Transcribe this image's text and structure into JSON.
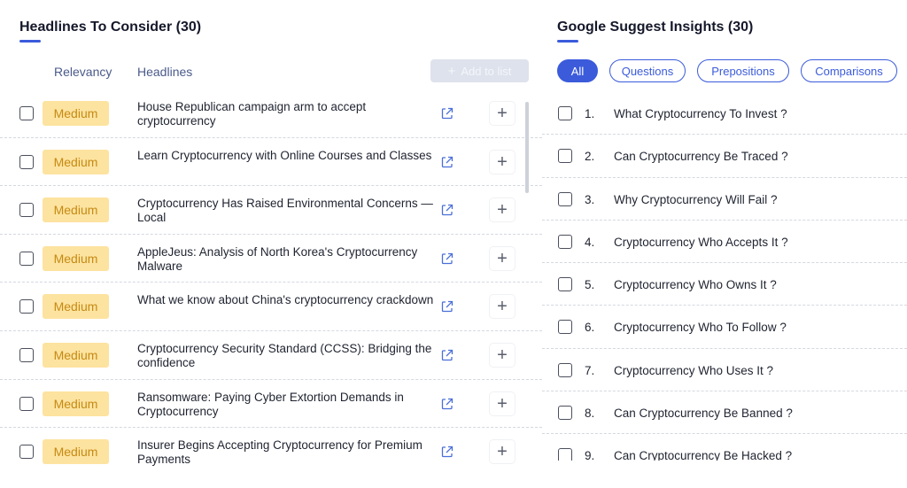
{
  "headlines": {
    "title": "Headlines To Consider (30)",
    "col_relevancy": "Relevancy",
    "col_headlines": "Headlines",
    "add_to_list": "Add to list",
    "items": [
      {
        "relevancy": "Medium",
        "text": "House Republican campaign arm to accept cryptocurrency"
      },
      {
        "relevancy": "Medium",
        "text": "Learn Cryptocurrency with Online Courses and Classes"
      },
      {
        "relevancy": "Medium",
        "text": "Cryptocurrency Has Raised Environmental Concerns — Local"
      },
      {
        "relevancy": "Medium",
        "text": "AppleJeus: Analysis of North Korea's Cryptocurrency Malware"
      },
      {
        "relevancy": "Medium",
        "text": "What we know about China's cryptocurrency crackdown"
      },
      {
        "relevancy": "Medium",
        "text": "Cryptocurrency Security Standard (CCSS): Bridging the confidence"
      },
      {
        "relevancy": "Medium",
        "text": "Ransomware: Paying Cyber Extortion Demands in Cryptocurrency"
      },
      {
        "relevancy": "Medium",
        "text": "Insurer Begins Accepting Cryptocurrency for Premium Payments"
      }
    ]
  },
  "suggest": {
    "title": "Google Suggest Insights (30)",
    "filters": [
      "All",
      "Questions",
      "Prepositions",
      "Comparisons"
    ],
    "active_filter": "All",
    "items": [
      {
        "num": "1.",
        "text": "What Cryptocurrency To Invest ?"
      },
      {
        "num": "2.",
        "text": "Can Cryptocurrency Be Traced ?"
      },
      {
        "num": "3.",
        "text": "Why Cryptocurrency Will Fail ?"
      },
      {
        "num": "4.",
        "text": "Cryptocurrency Who Accepts It ?"
      },
      {
        "num": "5.",
        "text": "Cryptocurrency Who Owns It ?"
      },
      {
        "num": "6.",
        "text": "Cryptocurrency Who To Follow ?"
      },
      {
        "num": "7.",
        "text": "Cryptocurrency Who Uses It ?"
      },
      {
        "num": "8.",
        "text": "Can Cryptocurrency Be Banned ?"
      },
      {
        "num": "9.",
        "text": "Can Cryptocurrency Be Hacked ?"
      }
    ]
  },
  "colors": {
    "accent": "#3b5bdb",
    "badge_bg": "#fde3a0",
    "badge_text": "#c58a13"
  }
}
